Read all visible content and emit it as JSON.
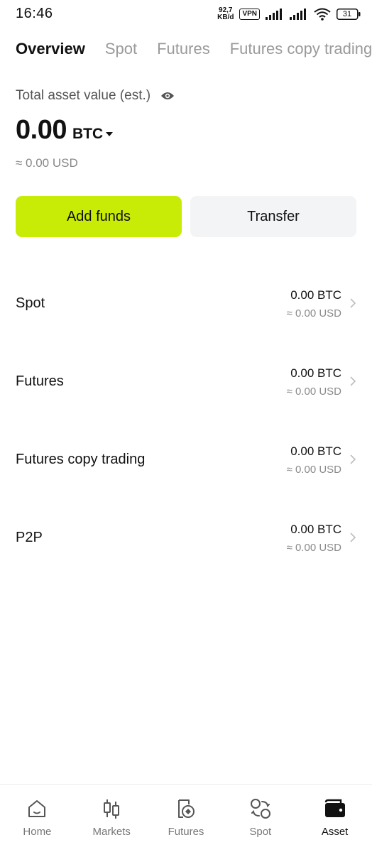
{
  "status_bar": {
    "time": "16:46",
    "net_speed_value": "92,7",
    "net_speed_unit": "KB/d",
    "vpn": "VPN",
    "battery": "31"
  },
  "tabs": [
    {
      "label": "Overview",
      "active": true
    },
    {
      "label": "Spot",
      "active": false
    },
    {
      "label": "Futures",
      "active": false
    },
    {
      "label": "Futures copy trading",
      "active": false
    }
  ],
  "total": {
    "label": "Total asset value (est.)",
    "value": "0.00",
    "unit": "BTC",
    "usd": "≈ 0.00 USD"
  },
  "buttons": {
    "add_funds": "Add funds",
    "transfer": "Transfer"
  },
  "accounts": [
    {
      "name": "Spot",
      "btc": "0.00 BTC",
      "usd": "≈ 0.00 USD"
    },
    {
      "name": "Futures",
      "btc": "0.00 BTC",
      "usd": "≈ 0.00 USD"
    },
    {
      "name": "Futures copy trading",
      "btc": "0.00 BTC",
      "usd": "≈ 0.00 USD"
    },
    {
      "name": "P2P",
      "btc": "0.00 BTC",
      "usd": "≈ 0.00 USD"
    }
  ],
  "bottom_nav": [
    {
      "label": "Home",
      "icon": "home-icon",
      "active": false
    },
    {
      "label": "Markets",
      "icon": "candlestick-icon",
      "active": false
    },
    {
      "label": "Futures",
      "icon": "futures-doc-icon",
      "active": false
    },
    {
      "label": "Spot",
      "icon": "swap-icon",
      "active": false
    },
    {
      "label": "Asset",
      "icon": "wallet-icon",
      "active": true
    }
  ],
  "colors": {
    "accent": "#c8ec06",
    "secondary_button": "#f3f4f6",
    "muted_text": "#888888"
  }
}
